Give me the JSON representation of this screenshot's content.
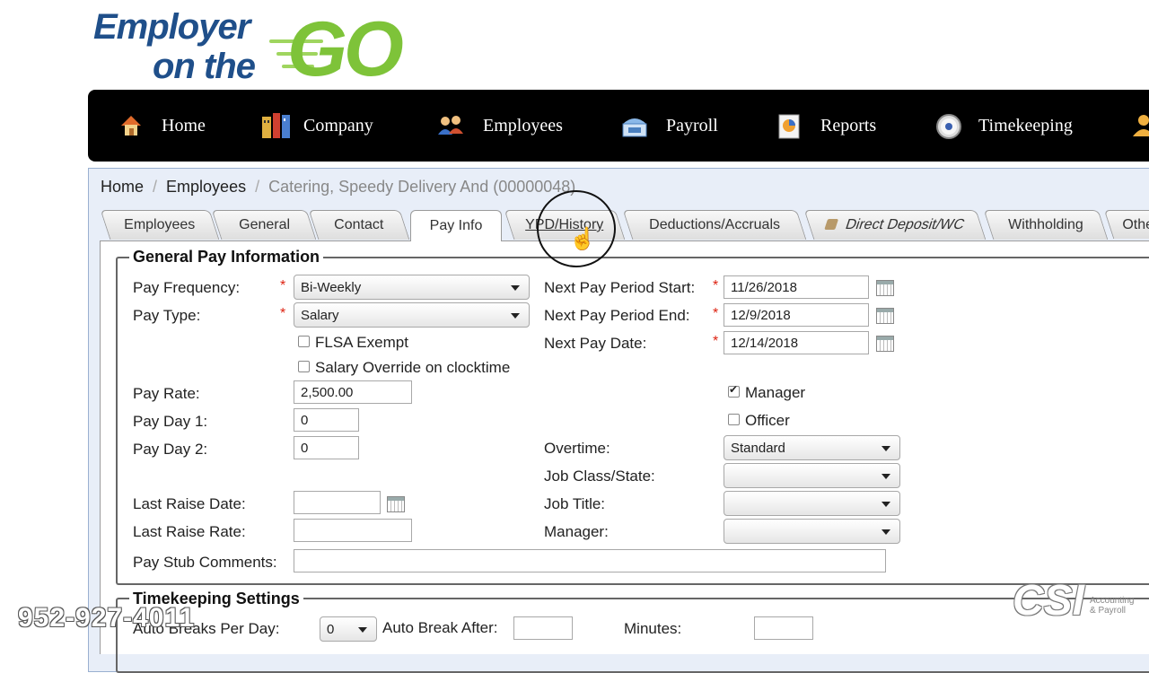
{
  "logo": {
    "line1": "Employer",
    "line2": "on the",
    "line3": "GO"
  },
  "nav": [
    {
      "label": "Home",
      "icon": "home-icon"
    },
    {
      "label": "Company",
      "icon": "building-icon"
    },
    {
      "label": "Employees",
      "icon": "people-icon"
    },
    {
      "label": "Payroll",
      "icon": "payroll-icon"
    },
    {
      "label": "Reports",
      "icon": "report-icon"
    },
    {
      "label": "Timekeeping",
      "icon": "clock-icon"
    }
  ],
  "breadcrumb": {
    "home": "Home",
    "sep": "/",
    "employees": "Employees",
    "current": "Catering, Speedy Delivery And (00000048)"
  },
  "tabs": [
    "Employees",
    "General",
    "Contact",
    "Pay Info",
    "YPD/History",
    "Deductions/Accruals",
    "Direct Deposit/WC",
    "Withholding",
    "Othe"
  ],
  "active_tab": "Pay Info",
  "general_pay": {
    "legend": "General Pay Information",
    "pay_frequency_label": "Pay Frequency:",
    "pay_frequency_value": "Bi-Weekly",
    "pay_type_label": "Pay Type:",
    "pay_type_value": "Salary",
    "req": "*",
    "flsa_label": "FLSA Exempt",
    "salary_override_label": "Salary Override on clocktime",
    "pay_rate_label": "Pay Rate:",
    "pay_rate_value": "2,500.00",
    "pay_day1_label": "Pay Day 1:",
    "pay_day1_value": "0",
    "pay_day2_label": "Pay Day 2:",
    "pay_day2_value": "0",
    "last_raise_date_label": "Last Raise Date:",
    "last_raise_rate_label": "Last Raise Rate:",
    "pay_stub_comments_label": "Pay Stub Comments:",
    "next_start_label": "Next Pay Period Start:",
    "next_start_value": "11/26/2018",
    "next_end_label": "Next Pay Period End:",
    "next_end_value": "12/9/2018",
    "next_pay_date_label": "Next Pay Date:",
    "next_pay_date_value": "12/14/2018",
    "manager_check_label": "Manager",
    "officer_check_label": "Officer",
    "overtime_label": "Overtime:",
    "overtime_value": "Standard",
    "job_class_label": "Job Class/State:",
    "job_title_label": "Job Title:",
    "manager_label": "Manager:"
  },
  "timekeeping": {
    "legend": "Timekeeping Settings",
    "auto_breaks_label": "Auto Breaks Per Day:",
    "auto_breaks_value": "0",
    "auto_break_after_label": "Auto Break After:",
    "minutes_label": "Minutes:"
  },
  "overlay": {
    "phone": "952-927-4011",
    "brand": "CSI",
    "brand_sub1": "Accounting",
    "brand_sub2": "& Payroll"
  }
}
